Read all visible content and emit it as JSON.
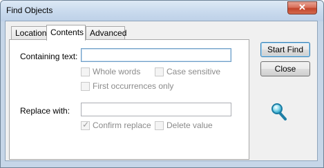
{
  "window": {
    "title": "Find Objects",
    "close_glyph": "✕"
  },
  "tabs": [
    {
      "label": "Location",
      "active": false
    },
    {
      "label": "Contents",
      "active": true
    },
    {
      "label": "Advanced",
      "active": false
    }
  ],
  "form": {
    "containing_label": "Containing text:",
    "containing_value": "",
    "whole_words": {
      "label": "Whole words",
      "checked": false
    },
    "case_sensitive": {
      "label": "Case sensitive",
      "checked": false
    },
    "first_occurrences": {
      "label": "First occurrences only",
      "checked": false
    },
    "replace_label": "Replace with:",
    "replace_value": "",
    "confirm_replace": {
      "label": "Confirm replace",
      "checked": true,
      "tick": "✓"
    },
    "delete_value": {
      "label": "Delete value",
      "checked": false
    }
  },
  "buttons": {
    "start_find": "Start Find",
    "close": "Close"
  },
  "icons": {
    "search": "magnifier-icon"
  },
  "colors": {
    "title_bar": "#c6d6e8",
    "close_button": "#c2442b",
    "focus_border": "#6f9fc7"
  }
}
